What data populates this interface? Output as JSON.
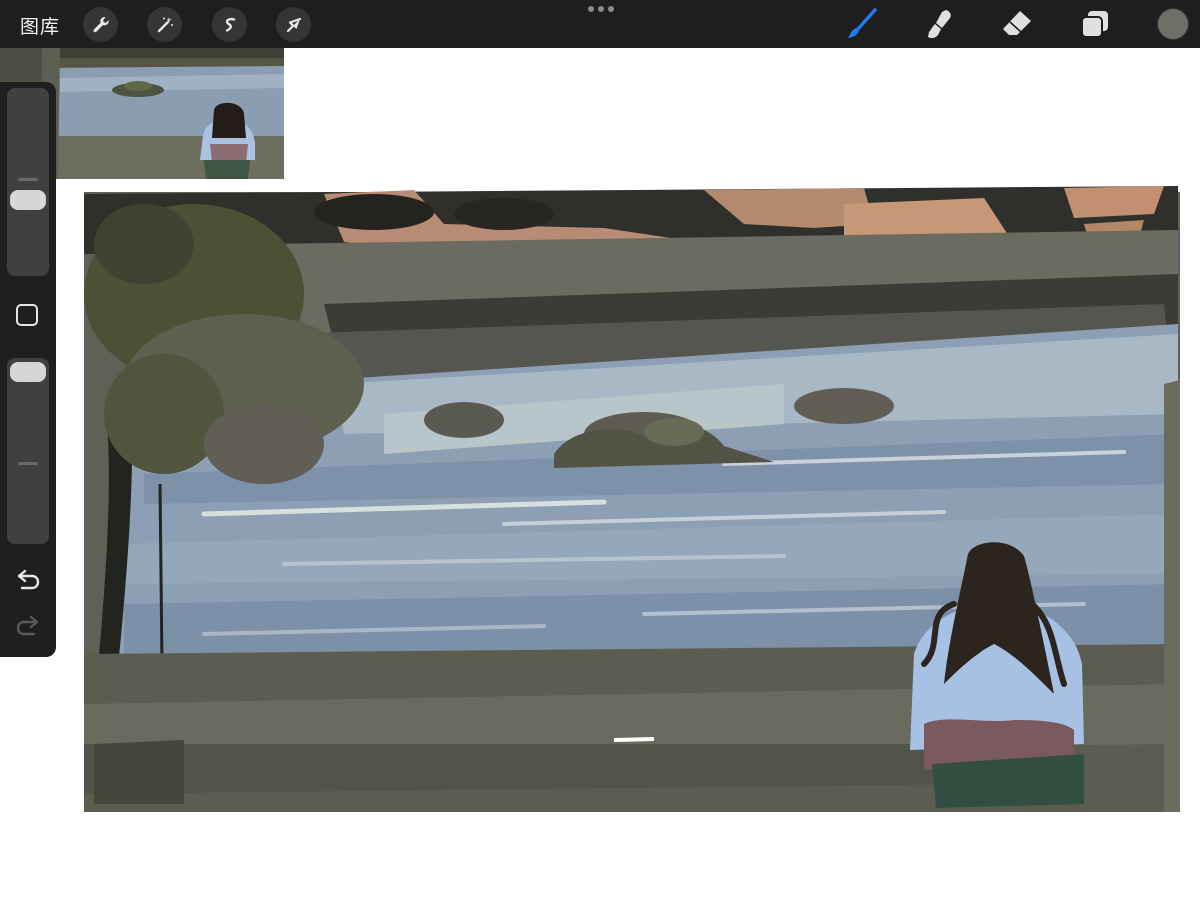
{
  "toolbar": {
    "gallery_label": "图库",
    "left_tools": [
      {
        "icon": "wrench-icon",
        "name": "actions"
      },
      {
        "icon": "magic-wand-icon",
        "name": "adjustments"
      },
      {
        "icon": "selection-icon",
        "name": "selection"
      },
      {
        "icon": "arrow-cursor-icon",
        "name": "transform"
      }
    ],
    "right_tools": [
      {
        "icon": "brush-icon",
        "name": "paint",
        "active": true
      },
      {
        "icon": "smudge-icon",
        "name": "smudge",
        "active": false
      },
      {
        "icon": "eraser-icon",
        "name": "erase",
        "active": false
      },
      {
        "icon": "layers-icon",
        "name": "layers",
        "active": false
      }
    ],
    "active_color": "#6f6f68",
    "accent_color": "#1e7bf2"
  },
  "sidebar": {
    "brush_size_level": 0.55,
    "opacity_level": 0.95,
    "modify_icon": "square-icon",
    "undo_icon": "undo-icon",
    "redo_icon": "redo-icon"
  },
  "canvas": {
    "reference_image": "lake-reference-photo",
    "artwork": "lake-painting-with-girl"
  }
}
